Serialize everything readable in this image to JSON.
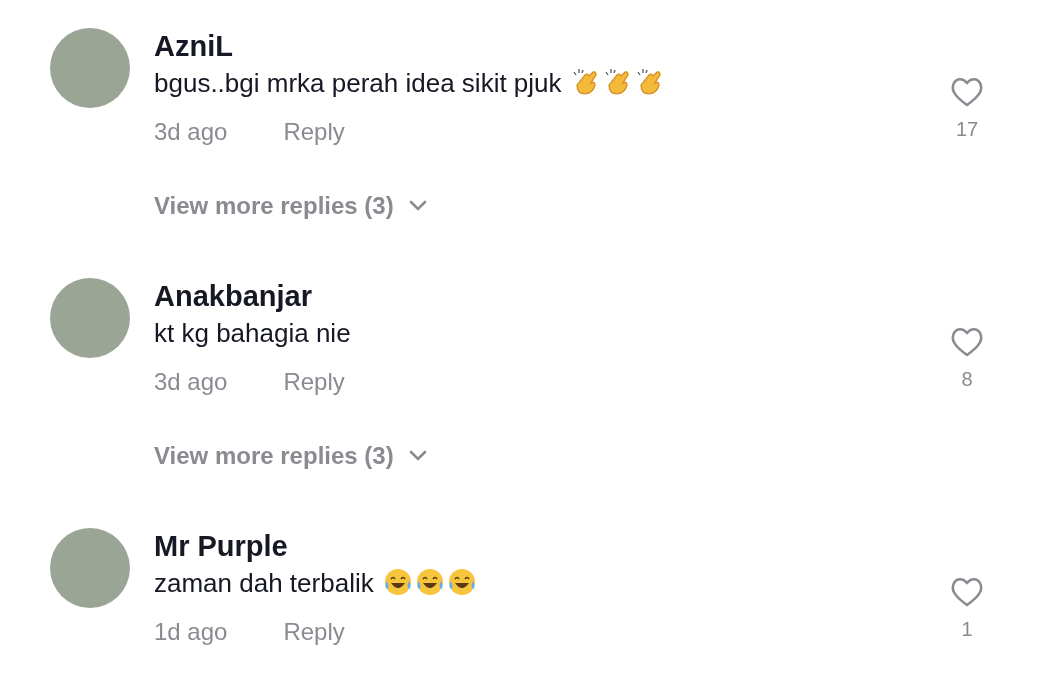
{
  "comments": [
    {
      "username": "AzniL",
      "text": "bgus..bgi mrka perah idea sikit pjuk",
      "emojis": [
        {
          "kind": "clap"
        },
        {
          "kind": "clap"
        },
        {
          "kind": "clap"
        }
      ],
      "time": "3d ago",
      "reply_label": "Reply",
      "liked": false,
      "likes": "17",
      "more_replies": "View more replies (3)"
    },
    {
      "username": "Anakbanjar",
      "text": "kt kg bahagia nie",
      "time": "3d ago",
      "reply_label": "Reply",
      "liked": false,
      "likes": "8",
      "more_replies": "View more replies (3)"
    },
    {
      "username": "Mr Purple",
      "text": "zaman dah terbalik",
      "emojis": [
        {
          "kind": "laugh"
        },
        {
          "kind": "laugh"
        },
        {
          "kind": "laugh"
        }
      ],
      "time": "1d ago",
      "reply_label": "Reply",
      "liked": false,
      "likes": "1"
    }
  ]
}
